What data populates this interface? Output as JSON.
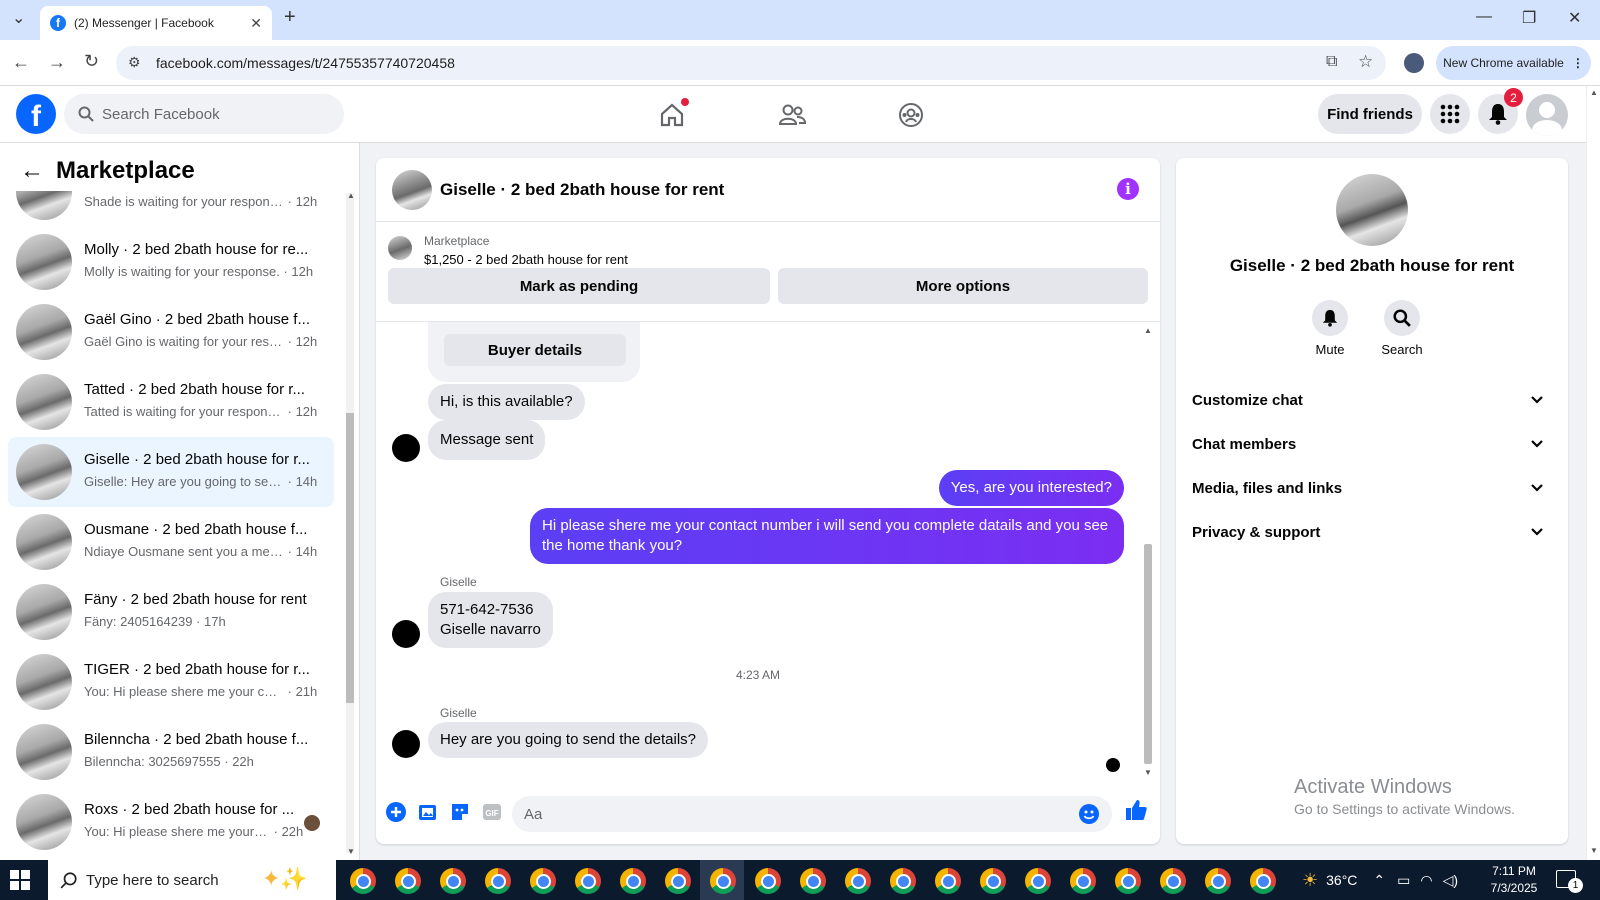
{
  "browser": {
    "tab_title": "(2) Messenger | Facebook",
    "url": "facebook.com/messages/t/24755357740720458",
    "new_chrome_label": "New Chrome available"
  },
  "fb_header": {
    "search_placeholder": "Search Facebook",
    "find_friends": "Find friends",
    "notification_count": "2"
  },
  "sidebar": {
    "title": "Marketplace",
    "conversations": [
      {
        "name": "",
        "preview": "Shade is waiting for your response.",
        "time": "12h"
      },
      {
        "name": "Molly · 2 bed 2bath house for re...",
        "preview": "Molly is waiting for your response.",
        "time": "12h"
      },
      {
        "name": "Gaël Gino · 2 bed 2bath house f...",
        "preview": "Gaël Gino is waiting for your resp...",
        "time": "12h"
      },
      {
        "name": "Tatted · 2 bed 2bath house for r...",
        "preview": "Tatted is waiting for your response.",
        "time": "12h"
      },
      {
        "name": "Giselle · 2 bed 2bath house for r...",
        "preview": "Giselle: Hey are you going to sen...",
        "time": "14h"
      },
      {
        "name": "Ousmane · 2 bed 2bath house f...",
        "preview": "Ndiaye Ousmane sent you a mess...",
        "time": "14h"
      },
      {
        "name": "Fäny · 2 bed 2bath house for rent",
        "preview": "Fäny: 2405164239",
        "time": "17h"
      },
      {
        "name": "TIGER · 2 bed 2bath house for r...",
        "preview": "You: Hi please shere me your cont...",
        "time": "21h"
      },
      {
        "name": "Bilenncha · 2 bed 2bath house f...",
        "preview": "Bilenncha: 3025697555",
        "time": "22h"
      },
      {
        "name": "Roxs · 2 bed 2bath house for ...",
        "preview": "You: Hi please shere me your c...",
        "time": "22h"
      }
    ]
  },
  "chat": {
    "title": "Giselle · 2 bed 2bath house for rent",
    "marketplace_label": "Marketplace",
    "listing": "$1,250 - 2 bed 2bath house for rent",
    "mark_pending": "Mark as pending",
    "more_options": "More options",
    "buyer_details": "Buyer details",
    "messages": {
      "m1": "Hi, is this available?",
      "m2": "Message sent",
      "m3": "Yes, are you interested?",
      "m4": "Hi please shere me your contact number i will send you complete datails and you see the home thank you?",
      "sender1": "Giselle",
      "m5_line1": "571-642-7536",
      "m5_line2": "Giselle navarro",
      "timestamp": "4:23 AM",
      "sender2": "Giselle",
      "m6": "Hey are you going to send the details?"
    },
    "input_placeholder": "Aa"
  },
  "right_panel": {
    "title": "Giselle · 2 bed 2bath house for rent",
    "mute": "Mute",
    "search": "Search",
    "rows": [
      "Customize chat",
      "Chat members",
      "Media, files and links",
      "Privacy & support"
    ]
  },
  "watermark": {
    "line1": "Activate Windows",
    "line2": "Go to Settings to activate Windows."
  },
  "taskbar": {
    "search_placeholder": "Type here to search",
    "temperature": "36°C",
    "time": "7:11 PM",
    "date": "7/3/2025",
    "notif_count": "1"
  }
}
